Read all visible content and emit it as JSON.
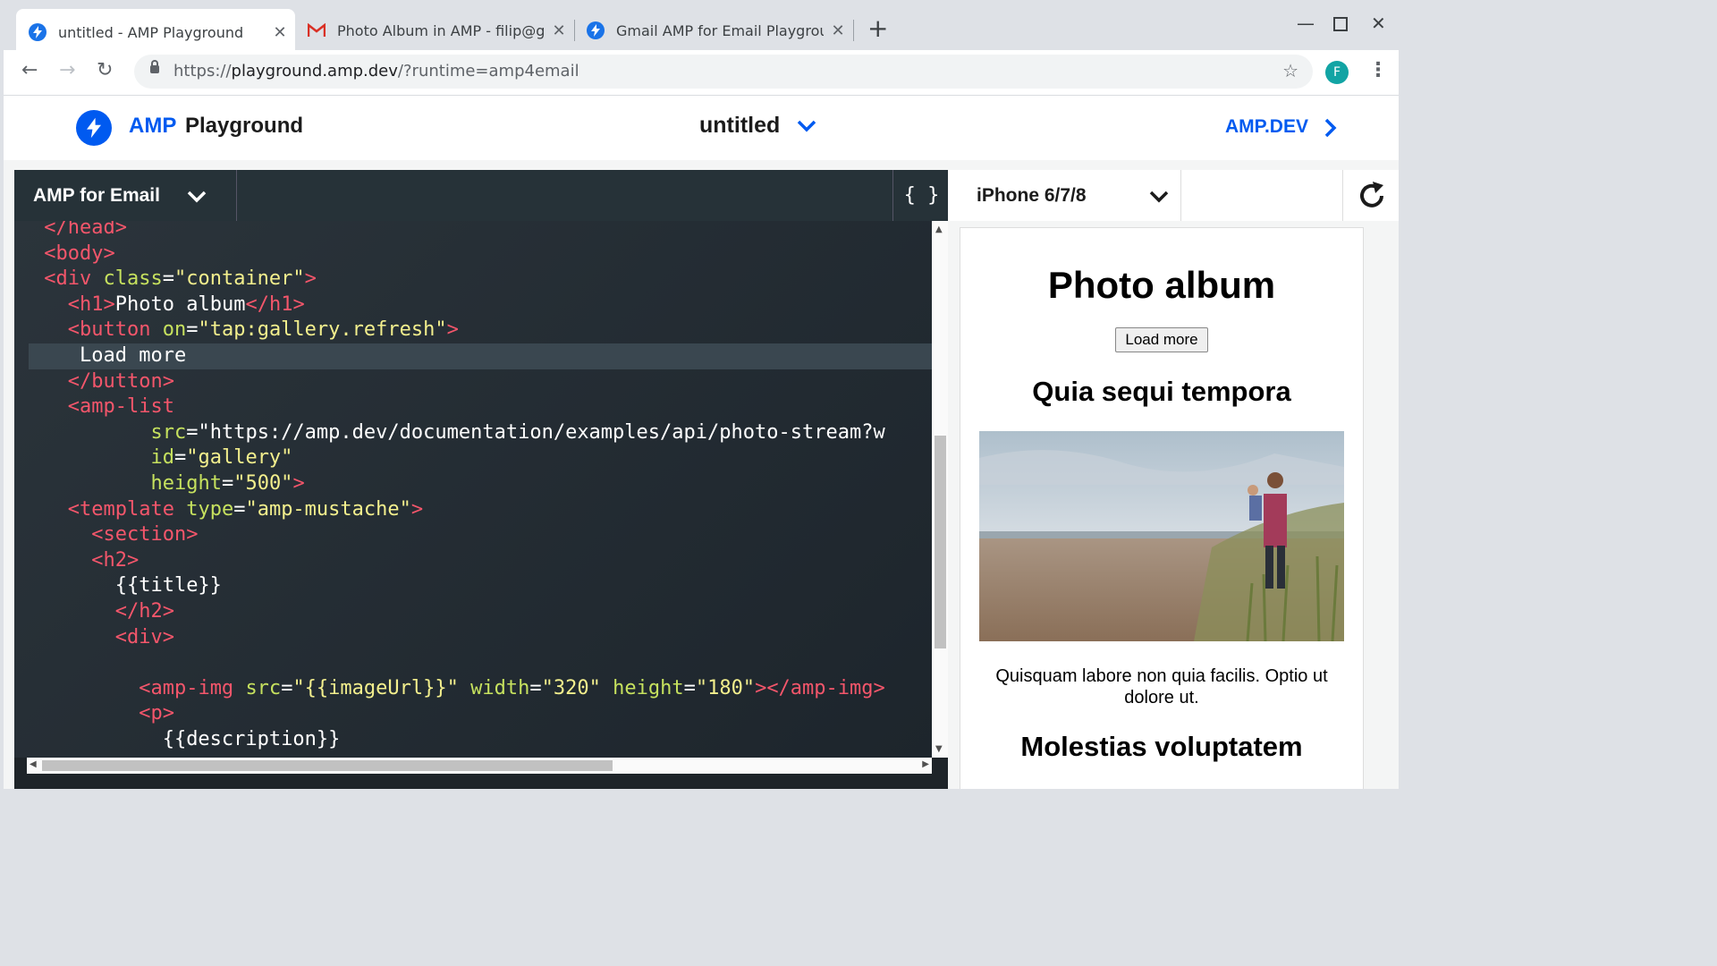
{
  "browser": {
    "tabs": [
      {
        "title": "untitled - AMP Playground",
        "icon": "amp-bolt-icon"
      },
      {
        "title": "Photo Album in AMP - filip@g",
        "icon": "gmail-icon"
      },
      {
        "title": "Gmail AMP for Email Playgrou",
        "icon": "amp-bolt-icon"
      }
    ],
    "url_scheme": "https://",
    "url_host": "playground.amp.dev",
    "url_path": "/?runtime=amp4email",
    "profile_initial": "F"
  },
  "header": {
    "brand_amp": "AMP",
    "brand_playground": "Playground",
    "doc_title": "untitled",
    "ampdev_link": "AMP.DEV"
  },
  "editor": {
    "mode": "AMP for Email",
    "format_label": "{ }"
  },
  "code_lines": [
    "</head>",
    "<body>",
    "<div class=\"container\">",
    "  <h1>Photo album</h1>",
    "  <button on=\"tap:gallery.refresh\">",
    "    Load more",
    "  </button>",
    "  <amp-list",
    "         src=\"https://amp.dev/documentation/examples/api/photo-stream?w",
    "         id=\"gallery\"",
    "         height=\"500\">",
    "  <template type=\"amp-mustache\">",
    "    <section>",
    "    <h2>",
    "      {{title}}",
    "      </h2>",
    "      <div>",
    "",
    "        <amp-img src=\"{{imageUrl}}\" width=\"320\" height=\"180\"></amp-img>",
    "        <p>",
    "          {{description}}"
  ],
  "preview": {
    "device": "iPhone 6/7/8",
    "h1": "Photo album",
    "button": "Load more",
    "item1_title": "Quia sequi tempora",
    "item1_description": "Quisquam labore non quia facilis. Optio ut dolore ut.",
    "item2_title": "Molestias voluptatem"
  },
  "colors": {
    "amp_blue": "#005af0",
    "code_tag": "#f4566b",
    "code_attr": "#c6e15e",
    "code_string": "#f3ef8d"
  }
}
